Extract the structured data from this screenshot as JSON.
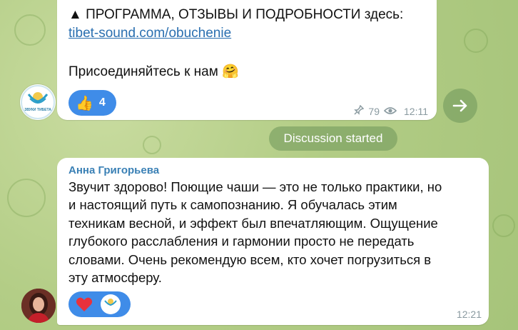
{
  "post": {
    "program_line": "▲ ПРОГРАММА, ОТЗЫВЫ И ПОДРОБНОСТИ здесь:",
    "link": "tibet-sound.com/obuchenie",
    "join_text": "Присоединяйтесь к нам",
    "join_emoji": "🤗",
    "reaction_emoji": "👍",
    "reaction_count": "4",
    "views": "79",
    "time": "12:11"
  },
  "channel": {
    "avatar_text": "ЗВУКИ ТИБЕТА"
  },
  "service": {
    "discussion_label": "Discussion started"
  },
  "comment": {
    "author": "Анна Григорьева",
    "lines": [
      "Звучит здорово! Поющие чаши — это не только практики, но",
      "и настоящий путь к самопознанию. Я обучалась этим",
      "техникам весной, и эффект был впечатляющим. Ощущение",
      "глубокого расслабления и гармонии просто не передать",
      "словами. Очень рекомендую всем, кто хочет погрузиться в",
      "эту атмосферу."
    ],
    "reaction_emoji": "❤️",
    "time": "12:21"
  },
  "colors": {
    "accent": "#3f8ce8",
    "link": "#2a6fb0",
    "author": "#3a80b5"
  }
}
